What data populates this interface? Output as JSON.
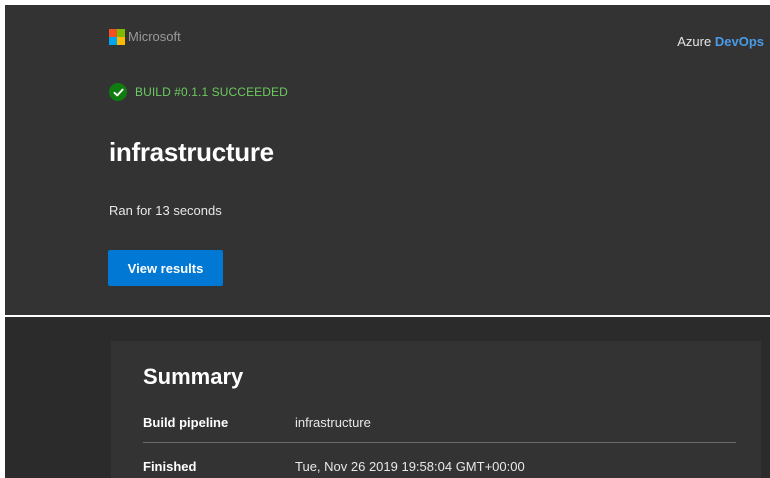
{
  "header": {
    "brand_text": "Microsoft",
    "brand_colors": [
      "#f25022",
      "#7fba00",
      "#00a4ef",
      "#ffb900"
    ],
    "product_prefix": "Azure",
    "product_name": "DevOps",
    "status_icon": "check-circle-icon",
    "status_color": "#107c10",
    "status_text": "BUILD #0.1.1 SUCCEEDED",
    "title": "infrastructure",
    "duration_text": "Ran for 13 seconds",
    "button_label": "View results",
    "accent_color": "#0078d4"
  },
  "summary": {
    "title": "Summary",
    "rows": [
      {
        "label": "Build pipeline",
        "value": "infrastructure"
      },
      {
        "label": "Finished",
        "value": "Tue, Nov 26 2019 19:58:04 GMT+00:00"
      }
    ]
  }
}
